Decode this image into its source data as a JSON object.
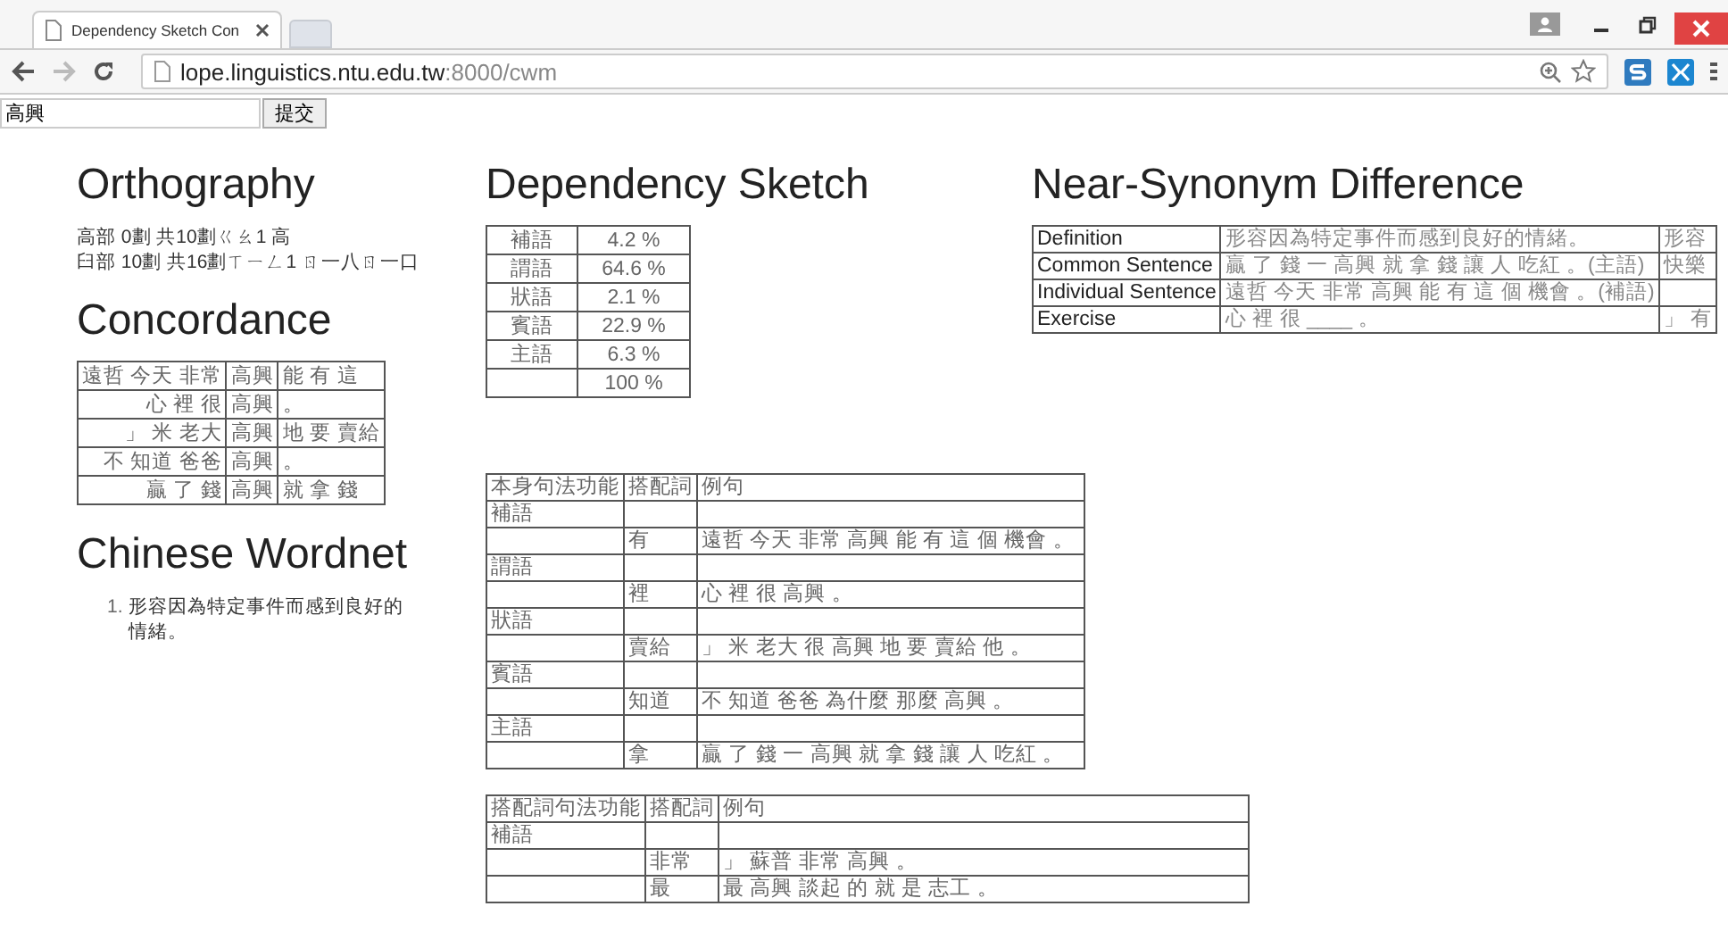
{
  "browser": {
    "tab_title": "Dependency Sketch Con",
    "url_host": "lope.linguistics.ntu.edu.tw",
    "url_rest": ":8000/cwm"
  },
  "search": {
    "value": "高興",
    "button": "提交"
  },
  "orthography": {
    "title": "Orthography",
    "lines": [
      "高部 0劃 共10劃ㄍㄠ1 高",
      "臼部 10劃 共16劃ㄒㄧㄥ1 ㄖ一八ㄖ一口"
    ]
  },
  "concordance": {
    "title": "Concordance",
    "rows": [
      {
        "left": "遠哲 今天 非常",
        "keyword": "高興",
        "right": "能 有 這"
      },
      {
        "left": "心 裡 很",
        "keyword": "高興",
        "right": "。"
      },
      {
        "left": "」 米 老大",
        "keyword": "高興",
        "right": "地 要 賣給"
      },
      {
        "left": "不 知道 爸爸",
        "keyword": "高興",
        "right": "。"
      },
      {
        "left": "贏 了 錢",
        "keyword": "高興",
        "right": "就 拿 錢"
      }
    ]
  },
  "wordnet": {
    "title": "Chinese Wordnet",
    "items": [
      {
        "number": "1.",
        "text": "形容因為特定事件而感到良好的情緒。"
      }
    ]
  },
  "dependency_sketch": {
    "title": "Dependency Sketch",
    "rows": [
      {
        "relation": "補語",
        "percent": "4.2 %"
      },
      {
        "relation": "謂語",
        "percent": "64.6 %"
      },
      {
        "relation": "狀語",
        "percent": "2.1 %"
      },
      {
        "relation": "賓語",
        "percent": "22.9 %"
      },
      {
        "relation": "主語",
        "percent": "6.3 %"
      },
      {
        "relation": "",
        "percent": "100 %"
      }
    ]
  },
  "near_synonym": {
    "title": "Near-Synonym Difference",
    "rows": [
      {
        "label": "Definition",
        "column_2": "形容因為特定事件而感到良好的情緒。",
        "column_3": "形容"
      },
      {
        "label": "Common Sentence",
        "column_2": "贏 了 錢 一 高興 就 拿 錢 讓 人 吃紅 。(主語)",
        "column_3": "快樂"
      },
      {
        "label": "Individual Sentence",
        "column_2": "遠哲 今天 非常 高興 能 有 這 個 機會 。(補語)",
        "column_3": ""
      },
      {
        "label": "Exercise",
        "column_2": "心 裡 很 ____ 。",
        "column_3": "」 有"
      }
    ]
  },
  "collocation_tables": [
    {
      "columns": [
        "本身句法功能",
        "搭配詞",
        "例句"
      ],
      "rows": [
        {
          "function": "補語",
          "collocate": "",
          "example": ""
        },
        {
          "function": "",
          "collocate": "有",
          "example": "遠哲 今天 非常 高興 能 有 這 個 機會 。"
        },
        {
          "function": "謂語",
          "collocate": "",
          "example": ""
        },
        {
          "function": "",
          "collocate": "裡",
          "example": "心 裡 很 高興 。"
        },
        {
          "function": "狀語",
          "collocate": "",
          "example": ""
        },
        {
          "function": "",
          "collocate": "賣給",
          "example": "」 米 老大 很 高興 地 要 賣給 他 。"
        },
        {
          "function": "賓語",
          "collocate": "",
          "example": ""
        },
        {
          "function": "",
          "collocate": "知道",
          "example": "不 知道 爸爸 為什麼 那麼 高興 。"
        },
        {
          "function": "主語",
          "collocate": "",
          "example": ""
        },
        {
          "function": "",
          "collocate": "拿",
          "example": "贏 了 錢 一 高興 就 拿 錢 讓 人 吃紅 。"
        }
      ]
    },
    {
      "columns": [
        "搭配詞句法功能",
        "搭配詞",
        "例句"
      ],
      "rows": [
        {
          "function": "補語",
          "collocate": "",
          "example": ""
        },
        {
          "function": "",
          "collocate": "非常",
          "example": "」 蘇普 非常 高興 。"
        },
        {
          "function": "",
          "collocate": "最",
          "example": "最 高興 談起 的 就 是 志工 。"
        }
      ]
    }
  ]
}
